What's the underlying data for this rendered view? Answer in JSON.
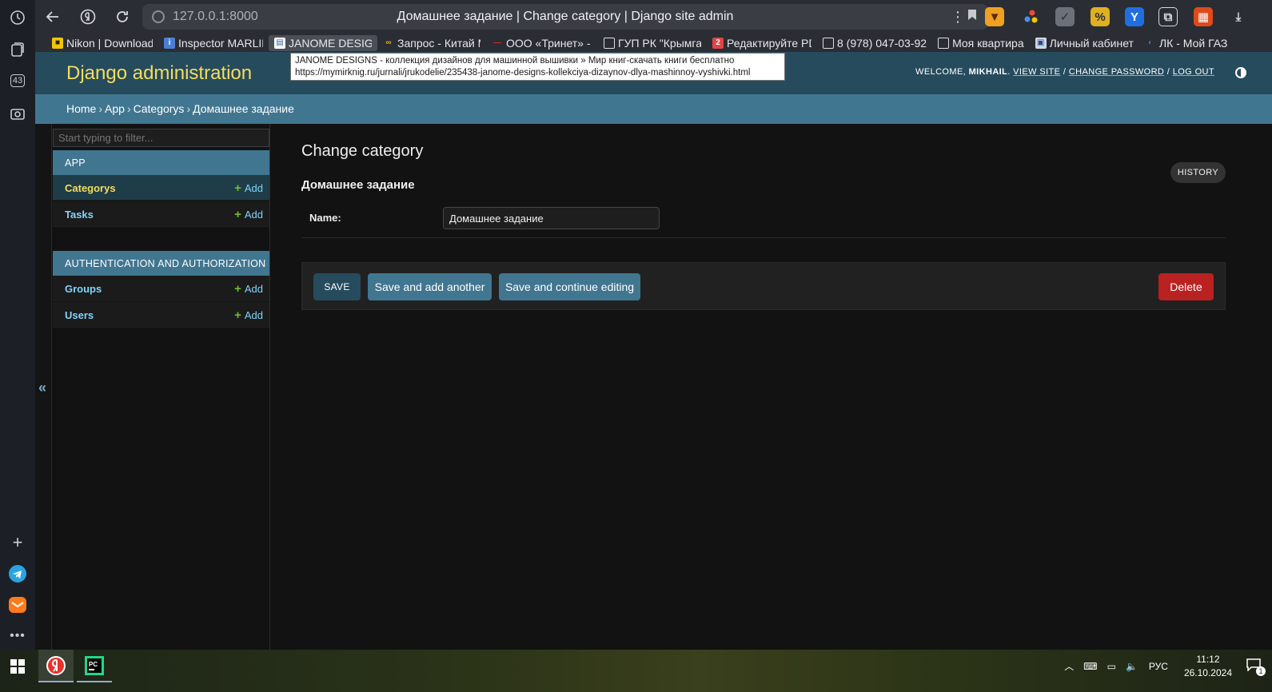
{
  "browser": {
    "url": "127.0.0.1:8000",
    "tab_title": "Домашнее задание | Change category | Django site admin",
    "rail_badge": "43",
    "bookmarks": [
      {
        "label": "Nikon | Download",
        "favicon_color": "#f5c400",
        "glyph": "■"
      },
      {
        "label": "Inspector MARLIN",
        "favicon_color": "#4a7fd4",
        "glyph": "i"
      },
      {
        "label": "JANOME DESIGNS",
        "favicon_color": "#2b5fb4",
        "glyph": "▤"
      },
      {
        "label": "Запрос - Китай М",
        "favicon_color": "#e0b020",
        "glyph": "∞"
      },
      {
        "label": "ООО «Тринет» - У",
        "favicon_color": "#d02a2a",
        "glyph": "—"
      },
      {
        "label": "ГУП РК \"Крымгаз",
        "favicon_color": "#dddddd",
        "glyph": "▯"
      },
      {
        "label": "Редактируйте PD",
        "favicon_color": "#e04545",
        "glyph": "2"
      },
      {
        "label": "8 (978) 047-03-92",
        "favicon_color": "#dddddd",
        "glyph": "▯"
      },
      {
        "label": "Моя квартира",
        "favicon_color": "#dddddd",
        "glyph": "▯"
      },
      {
        "label": "Личный кабинет",
        "favicon_color": "#cfd8e8",
        "glyph": "▣"
      },
      {
        "label": "ЛК - Мой ГАЗ",
        "favicon_color": "#3a6fd8",
        "glyph": "◐"
      }
    ],
    "tooltip": {
      "line1": "JANOME DESIGNS - коллекция дизайнов для машинной вышивки » Мир книг-скачать книги бесплатно",
      "line2": "https://mymirknig.ru/jurnali/jrukodelie/235438-janome-designs-kollekciya-dizaynov-dlya-mashinnoy-vyshivki.html"
    }
  },
  "admin": {
    "branding": "Django administration",
    "user_tools": {
      "welcome": "WELCOME,",
      "user": "MIKHAIL",
      "view_site": "VIEW SITE",
      "change_password": "CHANGE PASSWORD",
      "log_out": "LOG OUT",
      "separator": "/"
    },
    "breadcrumbs": [
      "Home",
      "App",
      "Categorys",
      "Домашнее задание"
    ],
    "sidebar": {
      "filter_placeholder": "Start typing to filter...",
      "add_label": "Add",
      "modules": [
        {
          "caption": "APP",
          "models": [
            {
              "name": "Categorys",
              "current": true
            },
            {
              "name": "Tasks",
              "current": false
            }
          ]
        },
        {
          "caption": "AUTHENTICATION AND AUTHORIZATION",
          "models": [
            {
              "name": "Groups",
              "current": false
            },
            {
              "name": "Users",
              "current": false
            }
          ]
        }
      ]
    },
    "content": {
      "title": "Change category",
      "object_title": "Домашнее задание",
      "history_label": "HISTORY",
      "field_label": "Name:",
      "field_value": "Домашнее задание",
      "save_label": "SAVE",
      "save_add_label": "Save and add another",
      "save_continue_label": "Save and continue editing",
      "delete_label": "Delete"
    }
  },
  "taskbar": {
    "language": "РУС",
    "time": "11:12",
    "date": "26.10.2024",
    "notification_count": "1"
  },
  "colors": {
    "header": "#264b5d",
    "breadcrumbs": "#417690",
    "branding": "#f5dd5d",
    "link": "#81d4fa",
    "delete": "#ba2121"
  }
}
